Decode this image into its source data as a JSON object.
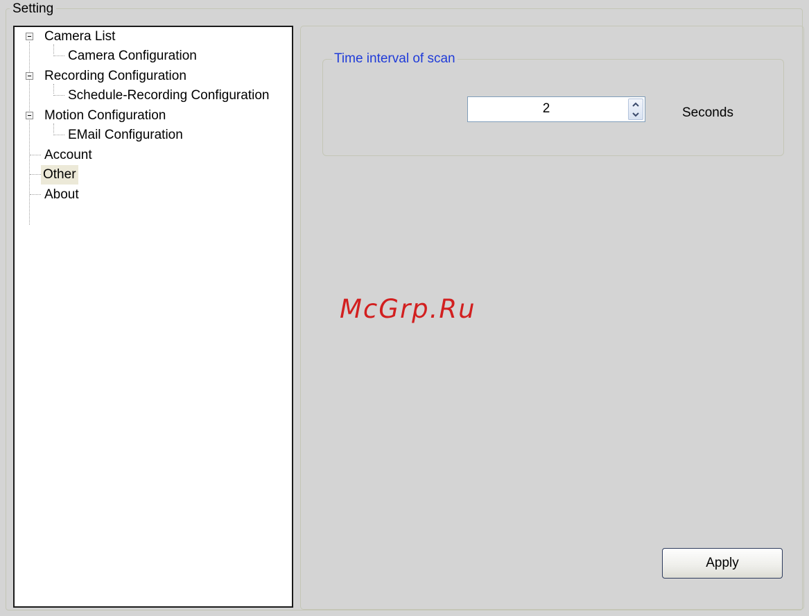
{
  "settings_group": {
    "title": "Setting"
  },
  "tree": {
    "items": [
      {
        "label": "Camera List",
        "level": 0,
        "expanded": true
      },
      {
        "label": "Camera Configuration",
        "level": 1
      },
      {
        "label": "Recording Configuration",
        "level": 0,
        "expanded": true
      },
      {
        "label": "Schedule-Recording Configuration",
        "level": 1
      },
      {
        "label": "Motion Configuration",
        "level": 0,
        "expanded": true
      },
      {
        "label": "EMail Configuration",
        "level": 1
      },
      {
        "label": "Account",
        "level": 0
      },
      {
        "label": "Other",
        "level": 0,
        "selected": true
      },
      {
        "label": "About",
        "level": 0
      }
    ]
  },
  "scan": {
    "title": "Time interval of scan",
    "value": "2",
    "unit": "Seconds"
  },
  "watermark": "McGrp.Ru",
  "apply_label": "Apply",
  "colors": {
    "legend_blue": "#1f3bd8",
    "watermark_red": "#d21f1f",
    "panel_bg": "#d4d4d4"
  }
}
